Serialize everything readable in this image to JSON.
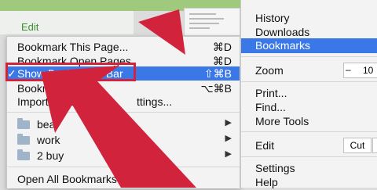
{
  "background": {
    "edit_label": "Edit"
  },
  "bookmarks_menu": {
    "items": [
      {
        "label": "Bookmark This Page...",
        "shortcut": "⌘D"
      },
      {
        "label": "Bookmark Open Pages",
        "shortcut": "⌘D"
      },
      {
        "label": "Show Bookmarks Bar",
        "shortcut": "⇧⌘B",
        "highlighted": true
      },
      {
        "label": "Bookmark M",
        "shortcut": "⌥⌘B"
      },
      {
        "label": "Import Bookm",
        "shortcut": ""
      }
    ],
    "import_tail": "ttings...",
    "folders": [
      {
        "label": "bea"
      },
      {
        "label": "work"
      },
      {
        "label": "2 buy"
      }
    ],
    "open_all": "Open All Bookmarks"
  },
  "chrome_menu": {
    "items": [
      {
        "label": "History"
      },
      {
        "label": "Downloads"
      },
      {
        "label": "Bookmarks",
        "highlighted": true
      },
      {
        "label": "Zoom"
      },
      {
        "label": "Print..."
      },
      {
        "label": "Find..."
      },
      {
        "label": "More Tools"
      },
      {
        "label": "Edit"
      },
      {
        "label": "Settings"
      },
      {
        "label": "Help"
      }
    ],
    "zoom_minus": "–",
    "zoom_value": "10",
    "cut_label": "Cut"
  },
  "colors": {
    "highlight": "#3b78e7",
    "annotation_red": "#d2233c",
    "menu_bg": "#f3f3f3"
  },
  "icons": [
    "folder-icon",
    "submenu-chevron-icon",
    "checkmark-icon",
    "annotation-arrow"
  ]
}
